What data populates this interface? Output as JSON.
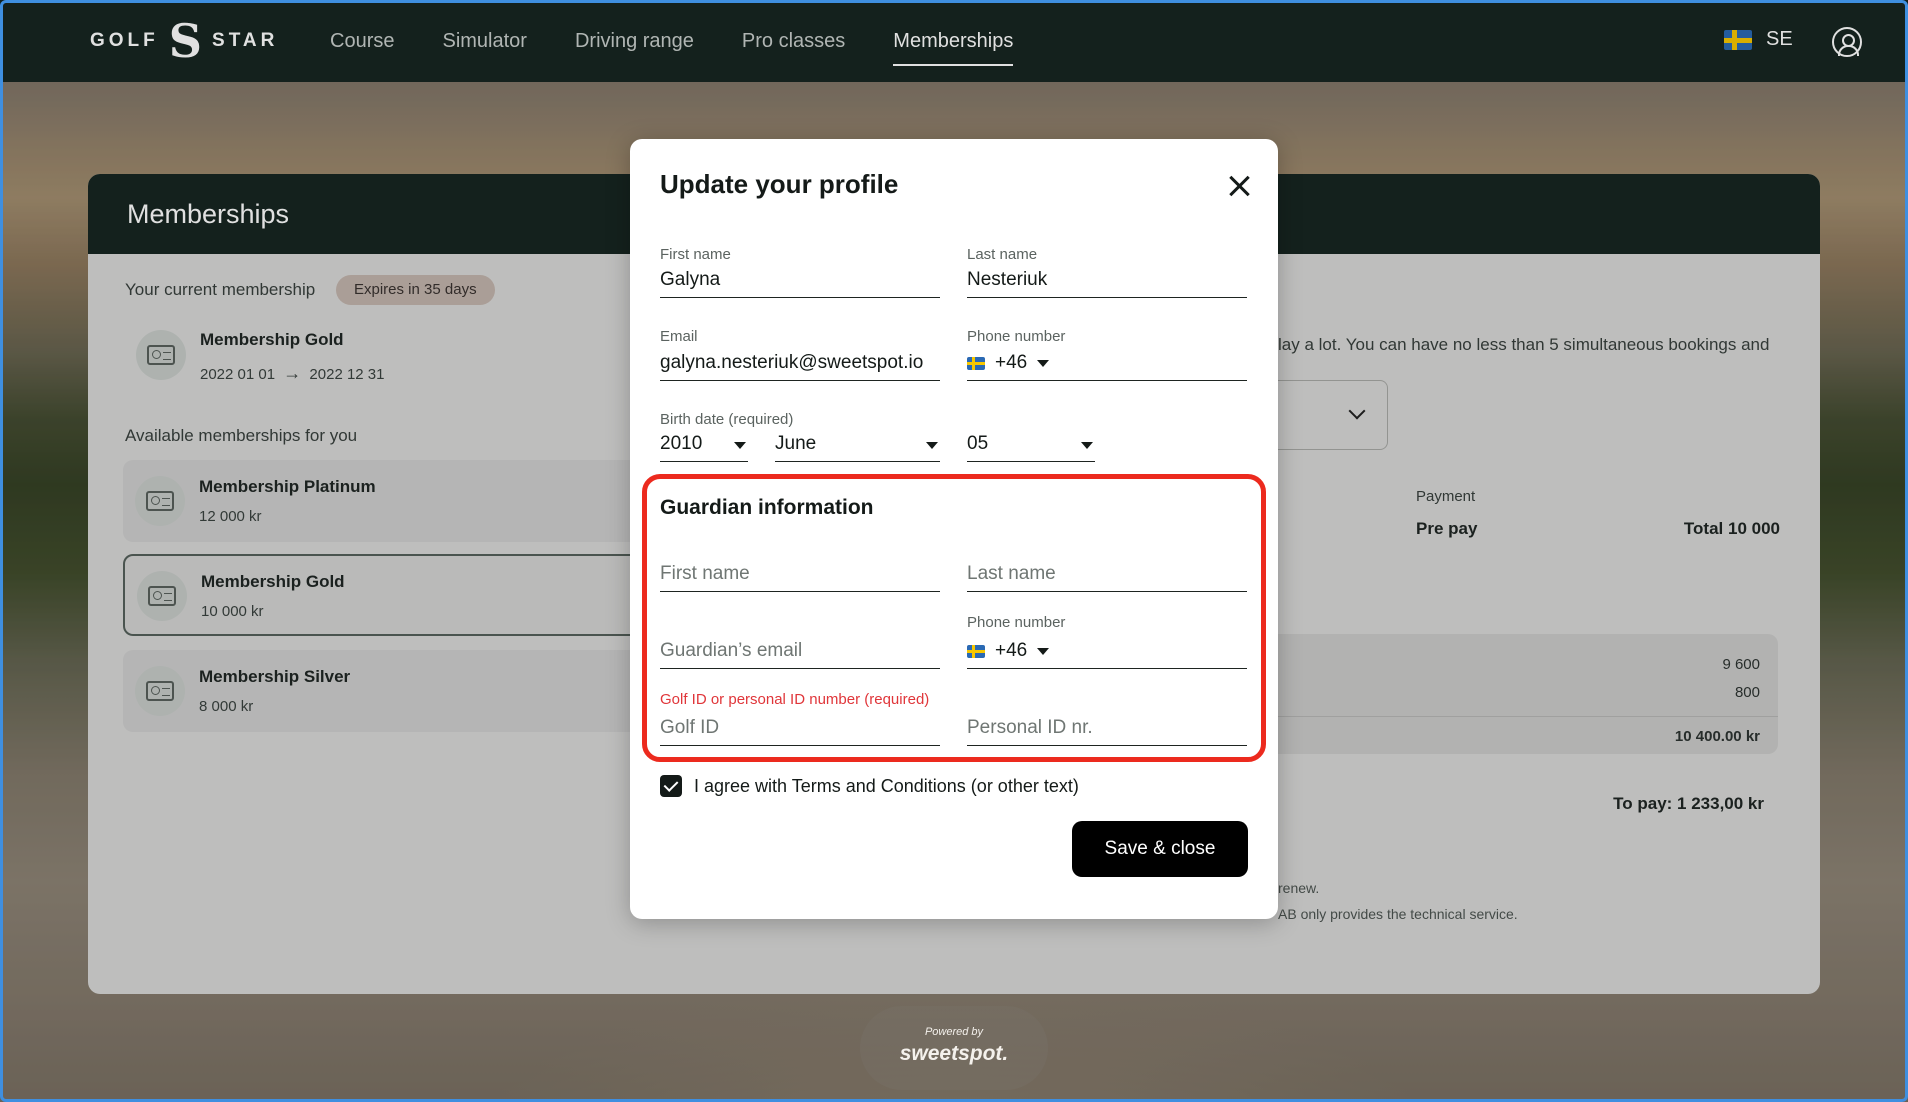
{
  "nav": {
    "logo_left": "GOLF",
    "logo_mark": "S",
    "logo_right": "STAR",
    "items": [
      "Course",
      "Simulator",
      "Driving range",
      "Pro classes",
      "Memberships"
    ],
    "active_index": 4,
    "language": "SE"
  },
  "memberships": {
    "title": "Memberships",
    "current_label": "Your current membership",
    "expires_badge": "Expires in 35 days",
    "current": {
      "name": "Membership Gold",
      "start": "2022 01 01",
      "arrow": "→",
      "end": "2022 12 31"
    },
    "available_label": "Available memberships for you",
    "available": [
      {
        "name": "Membership Platinum",
        "price": "12 000 kr"
      },
      {
        "name": "Membership Gold",
        "price": "10 000 kr"
      },
      {
        "name": "Membership Silver",
        "price": "8 000 kr"
      }
    ],
    "selected_index": 1,
    "description": "lay a lot. You can have no less than 5 simultaneous bookings and",
    "payment_label": "Payment",
    "payment_value": "Pre pay",
    "payment_total": "Total 10 000",
    "summary_values": [
      "9 600",
      "800",
      "10 400.00 kr"
    ],
    "to_pay": "To pay: 1 233,00 kr",
    "renew_text": "renew.",
    "service_text": "AB only provides the technical service."
  },
  "modal": {
    "title": "Update your profile",
    "first_name_label": "First name",
    "first_name_value": "Galyna",
    "last_name_label": "Last name",
    "last_name_value": "Nesteriuk",
    "email_label": "Email",
    "email_value": "galyna.nesteriuk@sweetspot.io",
    "phone_label": "Phone number",
    "phone_code": "+46",
    "birth_label": "Birth date (required)",
    "birth_year": "2010",
    "birth_month": "June",
    "birth_day": "05",
    "guardian": {
      "title": "Guardian information",
      "first_name_placeholder": "First name",
      "last_name_placeholder": "Last name",
      "email_placeholder": "Guardian’s email",
      "phone_label": "Phone number",
      "phone_code": "+46",
      "id_label": "Golf ID or personal ID number (required)",
      "golf_id_placeholder": "Golf ID",
      "personal_id_placeholder": "Personal ID nr."
    },
    "agree_text": "I agree with Terms and Conditions (or other text)",
    "agree_checked": true,
    "save_label": "Save & close"
  },
  "footer": {
    "powered_by": "Powered by",
    "brand": "sweetspot."
  },
  "colors": {
    "nav_bg": "#172621",
    "highlight": "#ec2a1e",
    "error_label": "#e0363a",
    "button": "#000000"
  }
}
